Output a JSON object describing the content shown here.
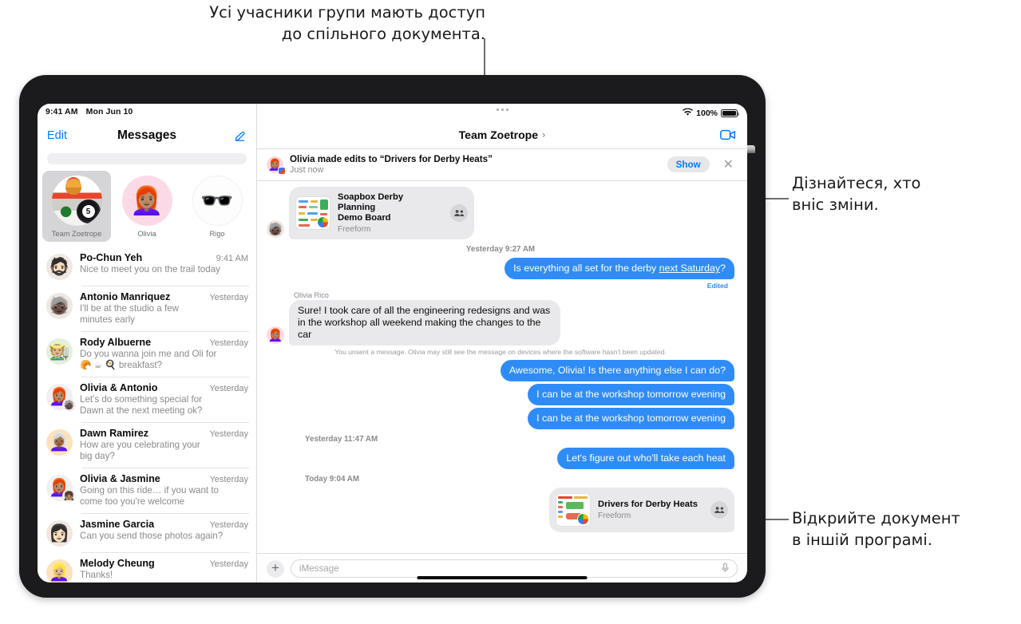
{
  "callouts": {
    "top": "Усі учасники групи мають доступ\nдо спільного документа.",
    "right_upper": "Дізнайтеся, хто\nвніс зміни.",
    "right_lower": "Відкрийте документ\nв іншій програмі."
  },
  "sidebar": {
    "status_time": "9:41 AM",
    "status_date": "Mon Jun 10",
    "edit_label": "Edit",
    "title": "Messages",
    "compose_icon": "compose-icon",
    "search_placeholder": "",
    "pinned": [
      {
        "label": "Team Zoetrope",
        "selected": true,
        "glyph": ""
      },
      {
        "label": "Olivia",
        "selected": false,
        "glyph": "👩🏽‍🦰"
      },
      {
        "label": "Rigo",
        "selected": false,
        "glyph": "🕶️"
      }
    ],
    "conversations": [
      {
        "name": "Po-Chun Yeh",
        "time": "9:41 AM",
        "preview": "Nice to meet you on the trail today",
        "glyph": "🧔🏻"
      },
      {
        "name": "Antonio Manriquez",
        "time": "Yesterday",
        "preview": "I'll be at the studio a few\nminutes early",
        "glyph": "🧓🏿"
      },
      {
        "name": "Rody Albuerne",
        "time": "Yesterday",
        "preview": "Do you wanna join me and Oli for\n🥐 ☕ 🍳 breakfast?",
        "glyph": "🧑🏼‍🌾"
      },
      {
        "name": "Olivia & Antonio",
        "time": "Yesterday",
        "preview": "Let's do something special for\nDawn at the next meeting ok?",
        "glyph": "👩🏽‍🦰",
        "badge": "🧓🏿"
      },
      {
        "name": "Dawn Ramirez",
        "time": "Yesterday",
        "preview": "How are you celebrating your\nbig day?",
        "glyph": "👩🏾‍🦳"
      },
      {
        "name": "Olivia & Jasmine",
        "time": "Yesterday",
        "preview": "Going on this ride… if you want to\ncome too you're welcome",
        "glyph": "👩🏽‍🦰",
        "badge": "👧🏽"
      },
      {
        "name": "Jasmine Garcia",
        "time": "Yesterday",
        "preview": "Can you send those photos again?",
        "glyph": "👩🏻"
      },
      {
        "name": "Melody Cheung",
        "time": "Yesterday",
        "preview": "Thanks!",
        "glyph": "👱🏼‍♀️"
      }
    ]
  },
  "chat": {
    "status_wifi": "wifi-icon",
    "status_battery_percent": "100%",
    "title": "Team Zoetrope",
    "title_chevron": "›",
    "facetime_icon": "facetime-video-icon",
    "banner": {
      "title": "Olivia made edits to “Drivers for Derby Heats”",
      "subtitle": "Just now",
      "show_label": "Show",
      "close_icon": "close-icon"
    },
    "messages": [
      {
        "kind": "card",
        "side": "in",
        "avatar": "🧓🏿",
        "title": "Soapbox Derby Planning\nDemo Board",
        "subtitle": "Freeform",
        "people_icon": "people-group-icon"
      },
      {
        "kind": "time",
        "text": "Yesterday 9:27 AM"
      },
      {
        "kind": "bubble",
        "side": "out",
        "text_before": "Is everything all set for the derby ",
        "text_underlined": "next Saturday",
        "text_after": "?",
        "edited_label": "Edited"
      },
      {
        "kind": "bubble",
        "side": "in",
        "sender": "Olivia Rico",
        "avatar": "👩🏽‍🦰",
        "text": "Sure! I took care of all the engineering redesigns and was in the workshop all weekend making the changes to the car"
      },
      {
        "kind": "note",
        "text": "You unsent a message. Olivia may still see the message on devices where the software hasn't been updated."
      },
      {
        "kind": "bubble",
        "side": "out",
        "text": "Awesome, Olivia! Is there anything else I can do?"
      },
      {
        "kind": "bubble",
        "side": "out",
        "text": "I can be at the workshop tomorrow evening"
      },
      {
        "kind": "bubble",
        "side": "out",
        "text": "I can be at the workshop tomorrow evening"
      },
      {
        "kind": "time",
        "text": "Yesterday 11:47 AM"
      },
      {
        "kind": "bubble",
        "side": "out",
        "text": "Let's figure out who'll take each heat"
      },
      {
        "kind": "time",
        "text": "Today 9:04 AM"
      },
      {
        "kind": "card",
        "side": "out",
        "title": "Drivers for Derby Heats",
        "subtitle": "Freeform",
        "people_icon": "people-group-icon"
      }
    ],
    "input": {
      "plus_icon": "plus-icon",
      "placeholder": "iMessage",
      "mic_icon": "microphone-icon"
    }
  },
  "colors": {
    "accent_blue": "#007aff",
    "bubble_blue": "#2f8cf7",
    "bubble_gray": "#e9e9eb",
    "secondary_text": "#8a8a8e"
  }
}
